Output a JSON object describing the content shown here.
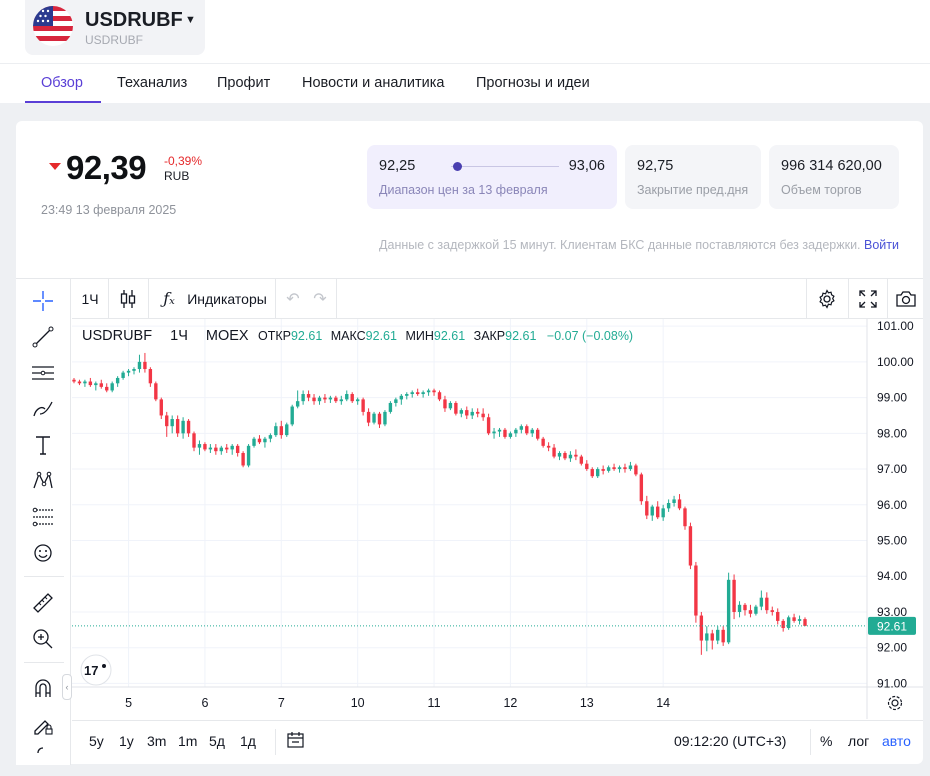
{
  "ticker": {
    "name": "USDRUBF",
    "sub": "USDRUBF"
  },
  "tabs": [
    "Обзор",
    "Теханализ",
    "Профит",
    "Новости и аналитика",
    "Прогнозы и идеи"
  ],
  "quote": {
    "price": "92,39",
    "change": "-0,39%",
    "currency": "RUB",
    "timestamp": "23:49 13 февраля 2025",
    "range_low": "92,25",
    "range_high": "93,06",
    "range_position": 0.09,
    "range_label": "Диапазон цен за 13 февраля",
    "prev_close": "92,75",
    "prev_close_label": "Закрытие пред.дня",
    "volume": "996 314 620,00",
    "volume_label": "Объем торгов"
  },
  "delay_note": "Данные с задержкой 15 минут. Клиентам БКС данные поставляются без задержки.",
  "login_link": "Войти",
  "chart_toolbar": {
    "interval": "1Ч",
    "indicators": "Индикаторы"
  },
  "chart_header": {
    "symbol": "USDRUBF",
    "interval": "1Ч",
    "exchange": "MOEX",
    "open_label": "ОТКР",
    "open": "92.61",
    "high_label": "МАКС",
    "high": "92.61",
    "low_label": "МИН",
    "low": "92.61",
    "close_label": "ЗАКР",
    "close": "92.61",
    "change": "−0.07 (−0.08%)"
  },
  "chart_bottom": {
    "ranges": [
      "5y",
      "1y",
      "3m",
      "1m",
      "5д",
      "1д"
    ],
    "time": "09:12:20 (UTC+3)",
    "percent": "%",
    "log": "лог",
    "auto": "авто"
  },
  "colors": {
    "accent": "#5a3fd6",
    "up": "#22ab94",
    "down": "#f23645",
    "price_line": "#22ab94"
  },
  "chart_data": {
    "type": "candlestick",
    "y_ticks": [
      "101.00",
      "100.00",
      "99.00",
      "98.00",
      "97.00",
      "96.00",
      "95.00",
      "94.00",
      "93.00",
      "92.00",
      "91.00"
    ],
    "ylim": [
      90.9,
      101.2
    ],
    "x_ticks": [
      {
        "label": "5",
        "index": 10
      },
      {
        "label": "6",
        "index": 24
      },
      {
        "label": "7",
        "index": 38
      },
      {
        "label": "10",
        "index": 52
      },
      {
        "label": "11",
        "index": 66
      },
      {
        "label": "12",
        "index": 80
      },
      {
        "label": "13",
        "index": 94
      },
      {
        "label": "14",
        "index": 108
      }
    ],
    "last_price": "92.61",
    "last_value": 92.61,
    "candles": [
      [
        99.5,
        99.55,
        99.4,
        99.45
      ],
      [
        99.45,
        99.5,
        99.35,
        99.4
      ],
      [
        99.4,
        99.5,
        99.3,
        99.45
      ],
      [
        99.45,
        99.55,
        99.3,
        99.35
      ],
      [
        99.35,
        99.45,
        99.2,
        99.4
      ],
      [
        99.4,
        99.5,
        99.25,
        99.3
      ],
      [
        99.3,
        99.4,
        99.15,
        99.2
      ],
      [
        99.2,
        99.45,
        99.15,
        99.4
      ],
      [
        99.4,
        99.6,
        99.3,
        99.55
      ],
      [
        99.55,
        99.75,
        99.5,
        99.7
      ],
      [
        99.7,
        99.8,
        99.6,
        99.75
      ],
      [
        99.75,
        99.85,
        99.65,
        99.8
      ],
      [
        99.8,
        100.2,
        99.7,
        100.0
      ],
      [
        100.0,
        100.25,
        99.7,
        99.8
      ],
      [
        99.8,
        99.85,
        99.3,
        99.4
      ],
      [
        99.4,
        99.45,
        98.9,
        98.95
      ],
      [
        98.95,
        99.0,
        98.4,
        98.5
      ],
      [
        98.5,
        98.6,
        97.9,
        98.2
      ],
      [
        98.2,
        98.5,
        98.0,
        98.4
      ],
      [
        98.4,
        98.5,
        97.9,
        98.0
      ],
      [
        98.0,
        98.45,
        97.85,
        98.35
      ],
      [
        98.35,
        98.4,
        97.9,
        98.0
      ],
      [
        98.0,
        98.05,
        97.5,
        97.6
      ],
      [
        97.6,
        97.8,
        97.4,
        97.7
      ],
      [
        97.7,
        97.75,
        97.5,
        97.55
      ],
      [
        97.55,
        97.7,
        97.45,
        97.6
      ],
      [
        97.6,
        97.7,
        97.4,
        97.5
      ],
      [
        97.5,
        97.65,
        97.4,
        97.6
      ],
      [
        97.6,
        97.7,
        97.45,
        97.55
      ],
      [
        97.55,
        97.7,
        97.4,
        97.65
      ],
      [
        97.65,
        97.7,
        97.35,
        97.45
      ],
      [
        97.45,
        97.5,
        97.05,
        97.1
      ],
      [
        97.1,
        97.7,
        97.05,
        97.65
      ],
      [
        97.65,
        97.9,
        97.6,
        97.85
      ],
      [
        97.85,
        97.95,
        97.7,
        97.75
      ],
      [
        97.75,
        97.9,
        97.6,
        97.85
      ],
      [
        97.85,
        98.0,
        97.75,
        97.95
      ],
      [
        97.95,
        98.3,
        97.9,
        98.2
      ],
      [
        98.2,
        98.35,
        97.85,
        97.95
      ],
      [
        97.95,
        98.3,
        97.9,
        98.25
      ],
      [
        98.25,
        98.8,
        98.2,
        98.75
      ],
      [
        98.75,
        99.2,
        98.7,
        98.9
      ],
      [
        98.9,
        99.2,
        98.8,
        99.1
      ],
      [
        99.1,
        99.2,
        98.9,
        99.0
      ],
      [
        99.0,
        99.1,
        98.8,
        98.9
      ],
      [
        98.9,
        99.05,
        98.8,
        99.0
      ],
      [
        99.0,
        99.1,
        98.85,
        98.95
      ],
      [
        98.95,
        99.05,
        98.85,
        99.0
      ],
      [
        99.0,
        99.05,
        98.85,
        98.9
      ],
      [
        98.9,
        99.05,
        98.8,
        98.95
      ],
      [
        98.95,
        99.2,
        98.9,
        99.1
      ],
      [
        99.1,
        99.15,
        98.85,
        98.9
      ],
      [
        98.9,
        99.0,
        98.8,
        98.95
      ],
      [
        98.95,
        99.0,
        98.5,
        98.6
      ],
      [
        98.6,
        98.7,
        98.2,
        98.3
      ],
      [
        98.3,
        98.6,
        98.25,
        98.55
      ],
      [
        98.55,
        98.6,
        98.15,
        98.25
      ],
      [
        98.25,
        98.65,
        98.2,
        98.6
      ],
      [
        98.6,
        98.9,
        98.55,
        98.85
      ],
      [
        98.85,
        99.0,
        98.75,
        98.95
      ],
      [
        98.95,
        99.1,
        98.8,
        99.05
      ],
      [
        99.05,
        99.15,
        98.95,
        99.1
      ],
      [
        99.1,
        99.2,
        99.0,
        99.15
      ],
      [
        99.15,
        99.25,
        99.05,
        99.1
      ],
      [
        99.1,
        99.2,
        99.0,
        99.15
      ],
      [
        99.15,
        99.25,
        99.05,
        99.2
      ],
      [
        99.2,
        99.25,
        99.05,
        99.15
      ],
      [
        99.15,
        99.2,
        98.9,
        98.95
      ],
      [
        98.95,
        99.05,
        98.6,
        98.7
      ],
      [
        98.7,
        98.9,
        98.65,
        98.85
      ],
      [
        98.85,
        98.9,
        98.5,
        98.55
      ],
      [
        98.55,
        98.7,
        98.45,
        98.65
      ],
      [
        98.65,
        98.75,
        98.4,
        98.5
      ],
      [
        98.5,
        98.7,
        98.4,
        98.6
      ],
      [
        98.6,
        98.7,
        98.45,
        98.55
      ],
      [
        98.55,
        98.7,
        98.35,
        98.45
      ],
      [
        98.45,
        98.55,
        97.95,
        98.0
      ],
      [
        98.0,
        98.15,
        97.85,
        98.05
      ],
      [
        98.05,
        98.15,
        97.9,
        98.1
      ],
      [
        98.1,
        98.15,
        97.85,
        97.9
      ],
      [
        97.9,
        98.05,
        97.85,
        98.0
      ],
      [
        98.0,
        98.15,
        97.9,
        98.1
      ],
      [
        98.1,
        98.25,
        98.0,
        98.2
      ],
      [
        98.2,
        98.25,
        97.95,
        98.0
      ],
      [
        98.0,
        98.15,
        97.9,
        98.1
      ],
      [
        98.1,
        98.15,
        97.8,
        97.85
      ],
      [
        97.85,
        97.9,
        97.6,
        97.65
      ],
      [
        97.65,
        97.75,
        97.5,
        97.6
      ],
      [
        97.6,
        97.7,
        97.3,
        97.35
      ],
      [
        97.35,
        97.5,
        97.25,
        97.45
      ],
      [
        97.45,
        97.5,
        97.25,
        97.3
      ],
      [
        97.3,
        97.5,
        97.2,
        97.4
      ],
      [
        97.4,
        97.55,
        97.25,
        97.35
      ],
      [
        97.35,
        97.4,
        97.1,
        97.15
      ],
      [
        97.15,
        97.25,
        96.95,
        97.0
      ],
      [
        97.0,
        97.05,
        96.75,
        96.8
      ],
      [
        96.8,
        97.05,
        96.75,
        97.0
      ],
      [
        97.0,
        97.1,
        96.85,
        96.95
      ],
      [
        96.95,
        97.1,
        96.9,
        97.05
      ],
      [
        97.05,
        97.15,
        96.95,
        97.0
      ],
      [
        97.0,
        97.1,
        96.9,
        97.05
      ],
      [
        97.05,
        97.15,
        96.9,
        97.0
      ],
      [
        97.0,
        97.2,
        96.95,
        97.1
      ],
      [
        97.1,
        97.15,
        96.8,
        96.85
      ],
      [
        96.85,
        96.9,
        96.0,
        96.1
      ],
      [
        96.1,
        96.25,
        95.6,
        95.7
      ],
      [
        95.7,
        96.0,
        95.55,
        95.95
      ],
      [
        95.95,
        96.1,
        95.6,
        95.65
      ],
      [
        95.65,
        96.0,
        95.55,
        95.9
      ],
      [
        95.9,
        96.15,
        95.8,
        96.05
      ],
      [
        96.05,
        96.25,
        95.95,
        96.15
      ],
      [
        96.15,
        96.3,
        95.85,
        95.9
      ],
      [
        95.9,
        95.95,
        95.3,
        95.4
      ],
      [
        95.4,
        95.5,
        94.2,
        94.3
      ],
      [
        94.3,
        94.4,
        92.7,
        92.9
      ],
      [
        92.9,
        93.0,
        91.8,
        92.2
      ],
      [
        92.2,
        92.6,
        91.9,
        92.4
      ],
      [
        92.4,
        92.5,
        91.95,
        92.2
      ],
      [
        92.2,
        92.6,
        92.1,
        92.5
      ],
      [
        92.5,
        92.6,
        92.05,
        92.15
      ],
      [
        92.15,
        94.1,
        92.1,
        93.9
      ],
      [
        93.9,
        94.05,
        92.8,
        93.0
      ],
      [
        93.0,
        93.3,
        92.85,
        93.2
      ],
      [
        93.2,
        93.25,
        92.9,
        93.05
      ],
      [
        93.05,
        93.2,
        92.85,
        92.95
      ],
      [
        92.95,
        93.2,
        92.9,
        93.15
      ],
      [
        93.15,
        93.6,
        93.05,
        93.4
      ],
      [
        93.4,
        93.55,
        92.95,
        93.05
      ],
      [
        93.05,
        93.15,
        92.9,
        93.0
      ],
      [
        93.0,
        93.1,
        92.65,
        92.75
      ],
      [
        92.75,
        92.8,
        92.45,
        92.55
      ],
      [
        92.55,
        92.9,
        92.5,
        92.85
      ],
      [
        92.85,
        92.95,
        92.7,
        92.75
      ],
      [
        92.75,
        92.9,
        92.65,
        92.8
      ],
      [
        92.8,
        92.85,
        92.6,
        92.61
      ]
    ]
  }
}
